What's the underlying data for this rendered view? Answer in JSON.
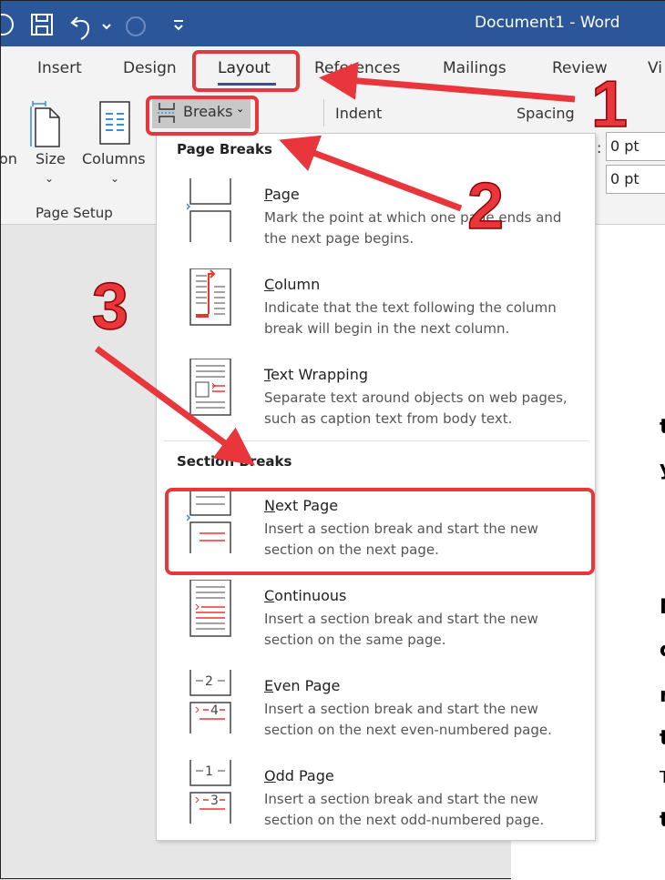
{
  "title_bar": {
    "title": "Document1  -  Word",
    "icons": [
      "account-icon",
      "save-icon",
      "undo-icon",
      "redo-icon",
      "customize-icon"
    ]
  },
  "tabs": [
    "Insert",
    "Design",
    "Layout",
    "References",
    "Mailings",
    "Review",
    "Vi"
  ],
  "active_tab": "Layout",
  "ribbon": {
    "size": "Size",
    "columns": "Columns",
    "orientation_partial": "on",
    "breaks": "Breaks",
    "group": "Page Setup",
    "indent": "Indent",
    "spacing": "Spacing",
    "spacing_before": "0 pt",
    "spacing_after": "0 pt",
    "colon": ":"
  },
  "menu": {
    "page_breaks_header": "Page Breaks",
    "section_breaks_header": "Section Breaks",
    "items": [
      {
        "title": "Page",
        "desc": "Mark the point at which one page ends and the next page begins."
      },
      {
        "title": "Column",
        "desc": "Indicate that the text following the column break will begin in the next column."
      },
      {
        "title": "Text Wrapping",
        "desc": "Separate text around objects on web pages, such as caption text from body text."
      },
      {
        "title": "Next Page",
        "desc": "Insert a section break and start the new section on the next page."
      },
      {
        "title": "Continuous",
        "desc": "Insert a section break and start the new section on the same page."
      },
      {
        "title": "Even Page",
        "desc": "Insert a section break and start the new section on the next even-numbered page."
      },
      {
        "title": "Odd Page",
        "desc": "Insert a section break and start the new section on the next odd-numbered page."
      }
    ]
  },
  "document_fragments": [
    "t",
    "y",
    "N",
    "c",
    "r",
    "t",
    "T",
    "t"
  ],
  "annotations": {
    "step1": "1",
    "step2": "2",
    "step3": "3",
    "color": "#e8363c"
  },
  "colors": {
    "title_bar": "#2b579a",
    "accent": "#2b579a",
    "annotation": "#e8363c"
  }
}
